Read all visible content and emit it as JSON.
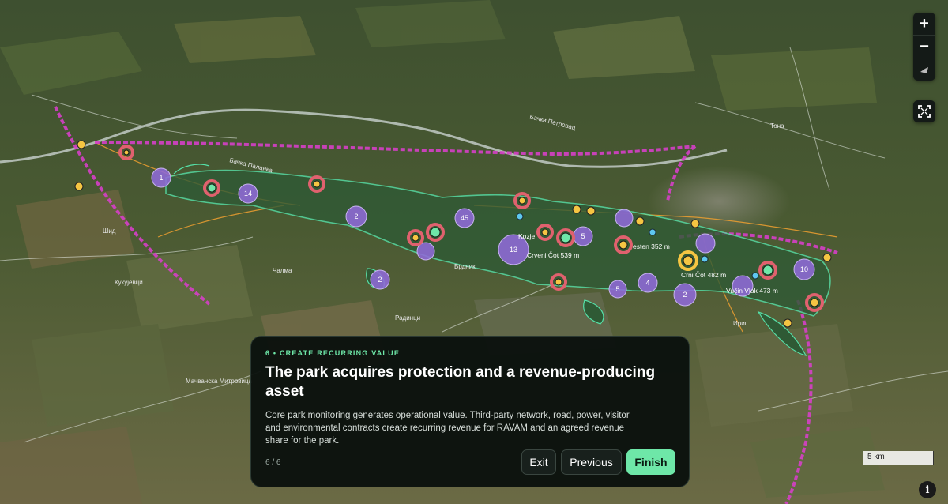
{
  "tour": {
    "eyebrow": "6 • CREATE RECURRING VALUE",
    "title": "The park acquires protection and a revenue-producing asset",
    "body": "Core park monitoring generates operational value. Third-party network, road, power, visitor and environmental contracts create recurring revenue for RAVAM and an agreed revenue share for the park.",
    "step": "6 / 6",
    "exit_label": "Exit",
    "previous_label": "Previous",
    "finish_label": "Finish"
  },
  "map_controls": {
    "zoom_in_icon": "plus-icon",
    "zoom_out_icon": "minus-icon",
    "compass_icon": "compass-icon",
    "fullscreen_icon": "fullscreen-icon",
    "info_icon": "info-icon",
    "scale_label": "5 km"
  },
  "peaks": [
    {
      "name": "Kozje",
      "elevation": ""
    },
    {
      "name": "Crveni Čot",
      "elevation": "539 m"
    },
    {
      "name": "esten",
      "elevation": "352 m"
    },
    {
      "name": "Crni Čot",
      "elevation": "482 m"
    },
    {
      "name": "Vučin Vlak",
      "elevation": "473 m"
    }
  ],
  "clusters": [
    {
      "count": "1"
    },
    {
      "count": "14"
    },
    {
      "count": "2"
    },
    {
      "count": "45"
    },
    {
      "count": "13"
    },
    {
      "count": "5"
    },
    {
      "count": "4"
    },
    {
      "count": "2"
    },
    {
      "count": "2"
    },
    {
      "count": "10"
    }
  ],
  "towns": [
    "Бачка Паланка",
    "Бачки Петровац",
    "Тона",
    "Шид",
    "Кукујевци",
    "Чалма",
    "Врдник",
    "Ириг",
    "Мачванска Митровица",
    "Радинци"
  ],
  "colors": {
    "park_outline": "#55e0a8",
    "cluster": "#8f6ad8",
    "marker_ring": "#e0616e",
    "marker_green": "#6ee7a8",
    "marker_yellow": "#f5c542",
    "railway": "#d63fc8",
    "accent": "#6ee7a8"
  }
}
